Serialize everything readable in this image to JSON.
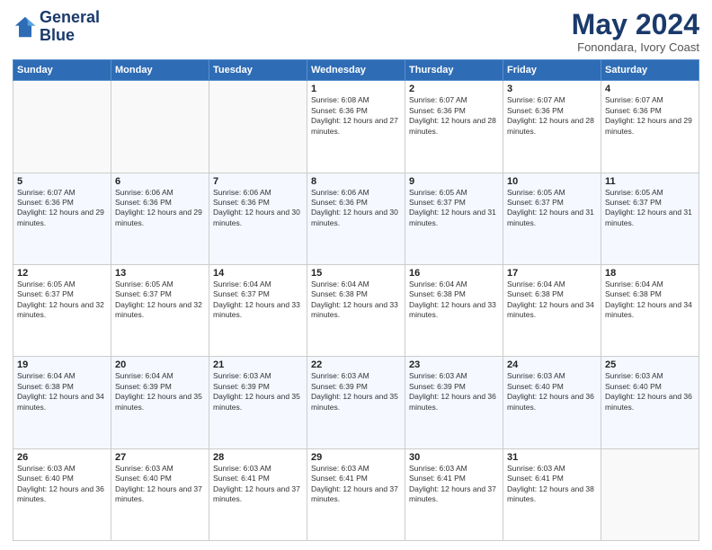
{
  "header": {
    "logo_line1": "General",
    "logo_line2": "Blue",
    "month": "May 2024",
    "location": "Fonondara, Ivory Coast"
  },
  "days_of_week": [
    "Sunday",
    "Monday",
    "Tuesday",
    "Wednesday",
    "Thursday",
    "Friday",
    "Saturday"
  ],
  "weeks": [
    [
      {
        "day": "",
        "sunrise": "",
        "sunset": "",
        "daylight": "",
        "empty": true
      },
      {
        "day": "",
        "sunrise": "",
        "sunset": "",
        "daylight": "",
        "empty": true
      },
      {
        "day": "",
        "sunrise": "",
        "sunset": "",
        "daylight": "",
        "empty": true
      },
      {
        "day": "1",
        "sunrise": "Sunrise: 6:08 AM",
        "sunset": "Sunset: 6:36 PM",
        "daylight": "Daylight: 12 hours and 27 minutes.",
        "empty": false
      },
      {
        "day": "2",
        "sunrise": "Sunrise: 6:07 AM",
        "sunset": "Sunset: 6:36 PM",
        "daylight": "Daylight: 12 hours and 28 minutes.",
        "empty": false
      },
      {
        "day": "3",
        "sunrise": "Sunrise: 6:07 AM",
        "sunset": "Sunset: 6:36 PM",
        "daylight": "Daylight: 12 hours and 28 minutes.",
        "empty": false
      },
      {
        "day": "4",
        "sunrise": "Sunrise: 6:07 AM",
        "sunset": "Sunset: 6:36 PM",
        "daylight": "Daylight: 12 hours and 29 minutes.",
        "empty": false
      }
    ],
    [
      {
        "day": "5",
        "sunrise": "Sunrise: 6:07 AM",
        "sunset": "Sunset: 6:36 PM",
        "daylight": "Daylight: 12 hours and 29 minutes.",
        "empty": false
      },
      {
        "day": "6",
        "sunrise": "Sunrise: 6:06 AM",
        "sunset": "Sunset: 6:36 PM",
        "daylight": "Daylight: 12 hours and 29 minutes.",
        "empty": false
      },
      {
        "day": "7",
        "sunrise": "Sunrise: 6:06 AM",
        "sunset": "Sunset: 6:36 PM",
        "daylight": "Daylight: 12 hours and 30 minutes.",
        "empty": false
      },
      {
        "day": "8",
        "sunrise": "Sunrise: 6:06 AM",
        "sunset": "Sunset: 6:36 PM",
        "daylight": "Daylight: 12 hours and 30 minutes.",
        "empty": false
      },
      {
        "day": "9",
        "sunrise": "Sunrise: 6:05 AM",
        "sunset": "Sunset: 6:37 PM",
        "daylight": "Daylight: 12 hours and 31 minutes.",
        "empty": false
      },
      {
        "day": "10",
        "sunrise": "Sunrise: 6:05 AM",
        "sunset": "Sunset: 6:37 PM",
        "daylight": "Daylight: 12 hours and 31 minutes.",
        "empty": false
      },
      {
        "day": "11",
        "sunrise": "Sunrise: 6:05 AM",
        "sunset": "Sunset: 6:37 PM",
        "daylight": "Daylight: 12 hours and 31 minutes.",
        "empty": false
      }
    ],
    [
      {
        "day": "12",
        "sunrise": "Sunrise: 6:05 AM",
        "sunset": "Sunset: 6:37 PM",
        "daylight": "Daylight: 12 hours and 32 minutes.",
        "empty": false
      },
      {
        "day": "13",
        "sunrise": "Sunrise: 6:05 AM",
        "sunset": "Sunset: 6:37 PM",
        "daylight": "Daylight: 12 hours and 32 minutes.",
        "empty": false
      },
      {
        "day": "14",
        "sunrise": "Sunrise: 6:04 AM",
        "sunset": "Sunset: 6:37 PM",
        "daylight": "Daylight: 12 hours and 33 minutes.",
        "empty": false
      },
      {
        "day": "15",
        "sunrise": "Sunrise: 6:04 AM",
        "sunset": "Sunset: 6:38 PM",
        "daylight": "Daylight: 12 hours and 33 minutes.",
        "empty": false
      },
      {
        "day": "16",
        "sunrise": "Sunrise: 6:04 AM",
        "sunset": "Sunset: 6:38 PM",
        "daylight": "Daylight: 12 hours and 33 minutes.",
        "empty": false
      },
      {
        "day": "17",
        "sunrise": "Sunrise: 6:04 AM",
        "sunset": "Sunset: 6:38 PM",
        "daylight": "Daylight: 12 hours and 34 minutes.",
        "empty": false
      },
      {
        "day": "18",
        "sunrise": "Sunrise: 6:04 AM",
        "sunset": "Sunset: 6:38 PM",
        "daylight": "Daylight: 12 hours and 34 minutes.",
        "empty": false
      }
    ],
    [
      {
        "day": "19",
        "sunrise": "Sunrise: 6:04 AM",
        "sunset": "Sunset: 6:38 PM",
        "daylight": "Daylight: 12 hours and 34 minutes.",
        "empty": false
      },
      {
        "day": "20",
        "sunrise": "Sunrise: 6:04 AM",
        "sunset": "Sunset: 6:39 PM",
        "daylight": "Daylight: 12 hours and 35 minutes.",
        "empty": false
      },
      {
        "day": "21",
        "sunrise": "Sunrise: 6:03 AM",
        "sunset": "Sunset: 6:39 PM",
        "daylight": "Daylight: 12 hours and 35 minutes.",
        "empty": false
      },
      {
        "day": "22",
        "sunrise": "Sunrise: 6:03 AM",
        "sunset": "Sunset: 6:39 PM",
        "daylight": "Daylight: 12 hours and 35 minutes.",
        "empty": false
      },
      {
        "day": "23",
        "sunrise": "Sunrise: 6:03 AM",
        "sunset": "Sunset: 6:39 PM",
        "daylight": "Daylight: 12 hours and 36 minutes.",
        "empty": false
      },
      {
        "day": "24",
        "sunrise": "Sunrise: 6:03 AM",
        "sunset": "Sunset: 6:40 PM",
        "daylight": "Daylight: 12 hours and 36 minutes.",
        "empty": false
      },
      {
        "day": "25",
        "sunrise": "Sunrise: 6:03 AM",
        "sunset": "Sunset: 6:40 PM",
        "daylight": "Daylight: 12 hours and 36 minutes.",
        "empty": false
      }
    ],
    [
      {
        "day": "26",
        "sunrise": "Sunrise: 6:03 AM",
        "sunset": "Sunset: 6:40 PM",
        "daylight": "Daylight: 12 hours and 36 minutes.",
        "empty": false
      },
      {
        "day": "27",
        "sunrise": "Sunrise: 6:03 AM",
        "sunset": "Sunset: 6:40 PM",
        "daylight": "Daylight: 12 hours and 37 minutes.",
        "empty": false
      },
      {
        "day": "28",
        "sunrise": "Sunrise: 6:03 AM",
        "sunset": "Sunset: 6:41 PM",
        "daylight": "Daylight: 12 hours and 37 minutes.",
        "empty": false
      },
      {
        "day": "29",
        "sunrise": "Sunrise: 6:03 AM",
        "sunset": "Sunset: 6:41 PM",
        "daylight": "Daylight: 12 hours and 37 minutes.",
        "empty": false
      },
      {
        "day": "30",
        "sunrise": "Sunrise: 6:03 AM",
        "sunset": "Sunset: 6:41 PM",
        "daylight": "Daylight: 12 hours and 37 minutes.",
        "empty": false
      },
      {
        "day": "31",
        "sunrise": "Sunrise: 6:03 AM",
        "sunset": "Sunset: 6:41 PM",
        "daylight": "Daylight: 12 hours and 38 minutes.",
        "empty": false
      },
      {
        "day": "",
        "sunrise": "",
        "sunset": "",
        "daylight": "",
        "empty": true
      }
    ]
  ]
}
